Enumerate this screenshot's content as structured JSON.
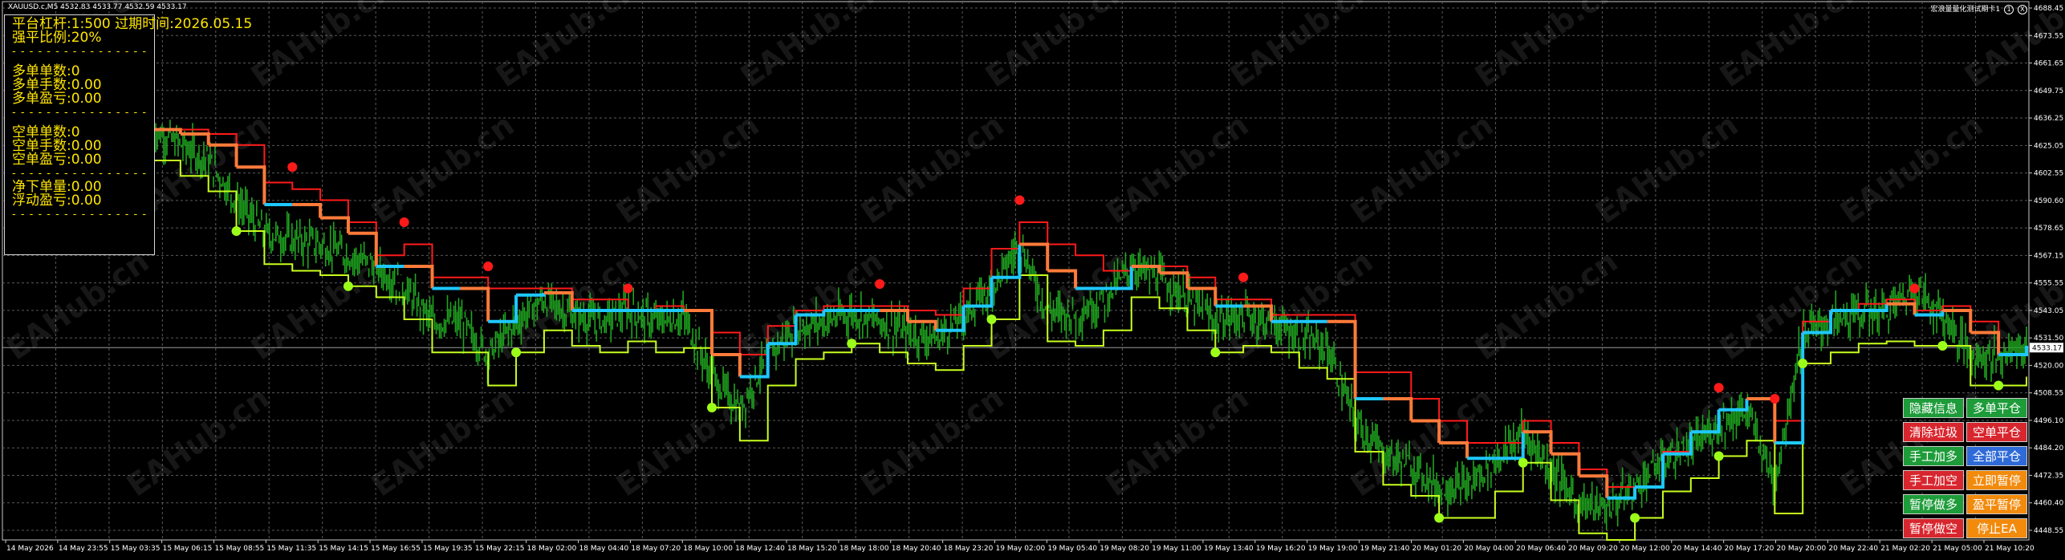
{
  "symbol_bar": "XAUUSD.c,M5  4532.83 4533.77 4532.59 4533.17",
  "top_right": {
    "label": "宏浪量量化测试期卡1",
    "btn1": "1",
    "btn2": "X"
  },
  "info_panel": {
    "line1": "平台杠杆:1:500 过期时间:2026.05.15",
    "line2": "强平比例:20%",
    "long_count": "多单单数:0",
    "long_lots": "多单手数:0.00",
    "long_pnl": "多单盈亏:0.00",
    "short_count": "空单单数:0",
    "short_lots": "空单手数:0.00",
    "short_pnl": "空单盈亏:0.00",
    "net_lots": "净下单量:0.00",
    "floating_pnl": "浮动盈亏:0.00",
    "divider": "- - - - - - - - - - - - - - - -"
  },
  "watermark": "EAHub.cn",
  "price_axis": {
    "labels": [
      "4688.45",
      "4673.55",
      "4661.65",
      "4649.75",
      "4636.25",
      "4625.05",
      "4602.55",
      "4590.60",
      "4578.65",
      "4567.15",
      "4555.55",
      "4543.05",
      "4531.50",
      "4520.00",
      "4508.55",
      "4496.10",
      "4484.20",
      "4472.35",
      "4460.40",
      "4448.55"
    ],
    "current": "4533.17",
    "min": 4446.0,
    "max": 4690.0
  },
  "time_axis": [
    "14 May 2026",
    "14 May 23:55",
    "15 May 03:35",
    "15 May 06:15",
    "15 May 08:55",
    "15 May 11:35",
    "15 May 14:15",
    "15 May 16:55",
    "15 May 19:35",
    "15 May 22:15",
    "18 May 02:00",
    "18 May 04:40",
    "18 May 07:20",
    "18 May 10:00",
    "18 May 12:40",
    "18 May 15:20",
    "18 May 18:00",
    "18 May 20:40",
    "18 May 23:20",
    "19 May 02:00",
    "19 May 05:40",
    "19 May 08:20",
    "19 May 11:00",
    "19 May 13:40",
    "19 May 16:20",
    "19 May 19:00",
    "19 May 21:40",
    "20 May 01:20",
    "20 May 04:00",
    "20 May 06:40",
    "20 May 09:20",
    "20 May 12:00",
    "20 May 14:40",
    "20 May 17:20",
    "20 May 20:00",
    "20 May 22:40",
    "21 May 02:20",
    "21 May 05:00",
    "21 May 10:20"
  ],
  "buttons": [
    {
      "id": "hide-info",
      "label": "隐藏信息",
      "color": "#1e9c3a"
    },
    {
      "id": "close-long",
      "label": "多单平仓",
      "color": "#1e9c3a"
    },
    {
      "id": "clear-garbage",
      "label": "清除垃圾",
      "color": "#d8262e"
    },
    {
      "id": "close-short",
      "label": "空单平仓",
      "color": "#d8262e"
    },
    {
      "id": "manual-add-long",
      "label": "手工加多",
      "color": "#1e9c3a"
    },
    {
      "id": "close-all",
      "label": "全部平仓",
      "color": "#2f6bd8"
    },
    {
      "id": "manual-add-short",
      "label": "手工加空",
      "color": "#d8262e"
    },
    {
      "id": "pause-now",
      "label": "立即暂停",
      "color": "#f28a0c"
    },
    {
      "id": "pause-long",
      "label": "暂停做多",
      "color": "#1e9c3a"
    },
    {
      "id": "profit-pause",
      "label": "盈平暂停",
      "color": "#f28a0c"
    },
    {
      "id": "pause-short",
      "label": "暂停做空",
      "color": "#d8262e"
    },
    {
      "id": "stop-ea",
      "label": "停止EA",
      "color": "#f28a0c"
    }
  ],
  "colors": {
    "background": "#000000",
    "grid": "#5a5a5a",
    "candles": "#1fa51f",
    "red_line": "#ff1a1a",
    "orange_line": "#ff7b3a",
    "cyan_line": "#1ec8ff",
    "lime_line": "#c8ff1e",
    "red_dot": "#ff1a1a",
    "green_dot": "#9cff1a",
    "text": "#ffe600"
  },
  "chart_data": {
    "type": "line",
    "x_labels_ref": "time_axis",
    "ylim": [
      4446.0,
      4690.0
    ],
    "series": [
      {
        "values": [
          4632,
          4625,
          4618,
          4600,
          4585,
          4582,
          4580,
          4575,
          4570,
          4560,
          4545,
          4545,
          4530,
          4545,
          4555,
          4548,
          4545,
          4550,
          4545,
          4547,
          4520,
          4505,
          4530,
          4542,
          4545,
          4549,
          4545,
          4540,
          4537,
          4548,
          4560,
          4580,
          4550,
          4548,
          4555,
          4570,
          4565,
          4555,
          4545,
          4548,
          4545,
          4538,
          4533,
          4500,
          4485,
          4480,
          4470,
          4470,
          4482,
          4495,
          4478,
          4463,
          4460,
          4470,
          4482,
          4488,
          4498,
          4505,
          4472,
          4540,
          4545,
          4549,
          4550,
          4560,
          4548,
          4530,
          4530,
          4534
        ]
      },
      {
        "values": [
          4632,
          4630,
          4625,
          4615,
          4598,
          4598,
          4592,
          4585,
          4570,
          4570,
          4560,
          4560,
          4545,
          4557,
          4558,
          4550,
          4550,
          4550,
          4550,
          4550,
          4530,
          4520,
          4535,
          4548,
          4550,
          4550,
          4550,
          4545,
          4541,
          4552,
          4565,
          4580,
          4568,
          4560,
          4560,
          4570,
          4567,
          4560,
          4552,
          4552,
          4545,
          4545,
          4545,
          4510,
          4510,
          4500,
          4490,
          4483,
          4483,
          4495,
          4485,
          4475,
          4465,
          4470,
          4485,
          4495,
          4505,
          4510,
          4490,
          4540,
          4550,
          4550,
          4553,
          4548,
          4550,
          4540,
          4530,
          4534
        ]
      },
      {
        "values": [
          4632,
          4632,
          4630,
          4625,
          4608,
          4605,
          4600,
          4590,
          4575,
          4580,
          4565,
          4565,
          4560,
          4560,
          4560,
          4555,
          4555,
          4550,
          4552,
          4550,
          4540,
          4530,
          4543,
          4550,
          4552,
          4552,
          4552,
          4550,
          4548,
          4560,
          4578,
          4590,
          4580,
          4575,
          4568,
          4570,
          4570,
          4565,
          4555,
          4555,
          4548,
          4548,
          4548,
          4522,
          4522,
          4510,
          4500,
          4490,
          4490,
          4500,
          4490,
          4478,
          4470,
          4470,
          4486,
          4495,
          4505,
          4510,
          4500,
          4545,
          4550,
          4553,
          4555,
          4550,
          4552,
          4545,
          4530,
          4534
        ]
      }
    ]
  }
}
